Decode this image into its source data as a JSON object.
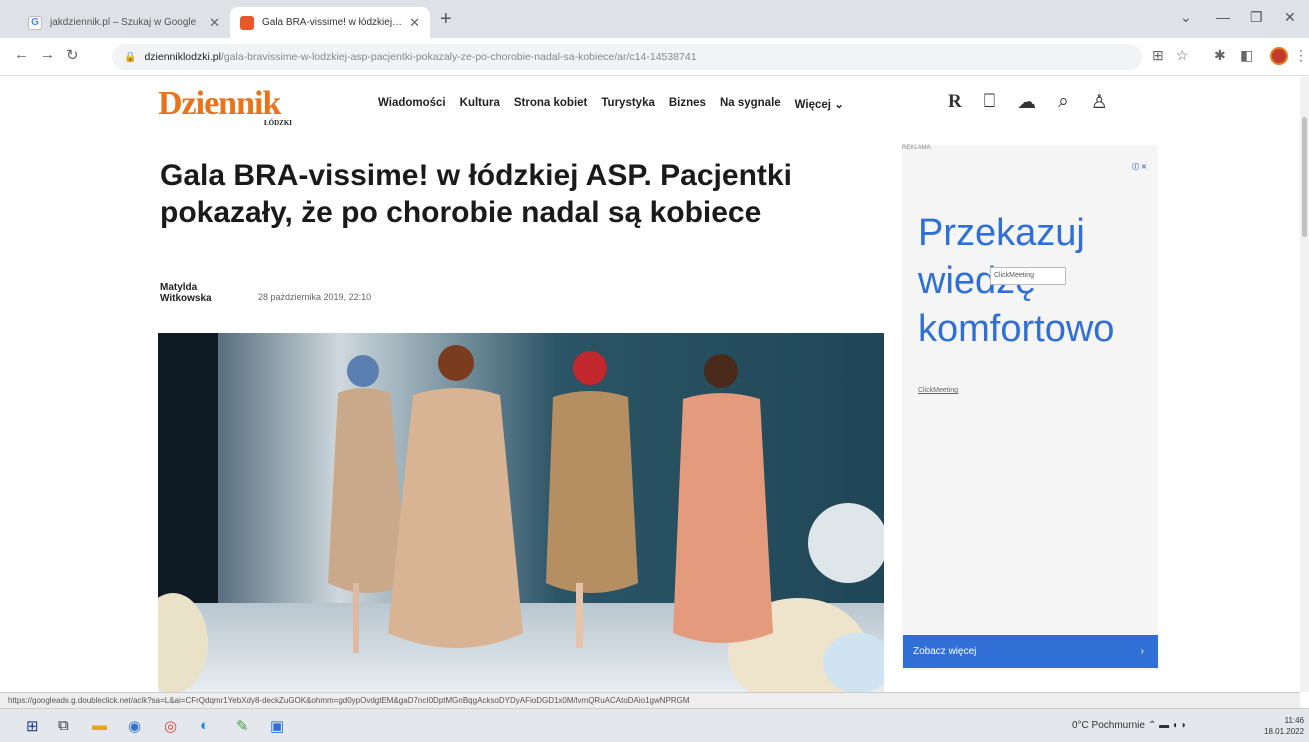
{
  "browser": {
    "tabs": [
      {
        "title": "jakdziennik.pl – Szukaj w Google",
        "active": false
      },
      {
        "title": "Gala BRA-vissime! w łódzkiej ASP.",
        "active": true
      }
    ],
    "address": {
      "domain": "dzienniklodzki.pl",
      "path": "/gala-bravissime-w-lodzkiej-asp-pacjentki-pokazaly-ze-po-chorobie-nadal-sa-kobiece/ar/c14-14538741"
    },
    "status_url": "https://googleads.g.doubleclick.net/aclk?sa=L&ai=CFrQdqmr1YebXdy8-deckZuGOK&ohmm=gd0ypOvdgtEM&gaD7ncI0DptMGnBqgAcksoDYDyAFioDGD1x0M/lvmQRuACAtoDAio1gwNPRGM"
  },
  "site": {
    "logo": "Dziennik",
    "logo_sub": "ŁÓDZKI",
    "nav": [
      "Wiadomości",
      "Kultura",
      "Strona kobiet",
      "Turystyka",
      "Biznes",
      "Na sygnale",
      "Więcej ⌄"
    ]
  },
  "article": {
    "headline": "Gala BRA-vissime! w łódzkiej ASP. Pacjentki pokazały, że po chorobie nadal są kobiece",
    "author_first": "Matylda",
    "author_last": "Witkowska",
    "date": "28 października 2019, 22:10"
  },
  "ad": {
    "label": "REKLAMA",
    "badge": "ⓘ ✕",
    "line1": "Przekazuj",
    "line2": "wiedzę",
    "line3": "komfortowo",
    "tooltip": "ClickMeeting",
    "brand": "ClickMeeting",
    "cta": "Zobacz więcej",
    "cta_arrow": "›",
    "color": "#2f6fd6"
  },
  "taskbar": {
    "weather": "0°C Pochmurnie",
    "time": "11:46",
    "date": "18.01.2022"
  }
}
